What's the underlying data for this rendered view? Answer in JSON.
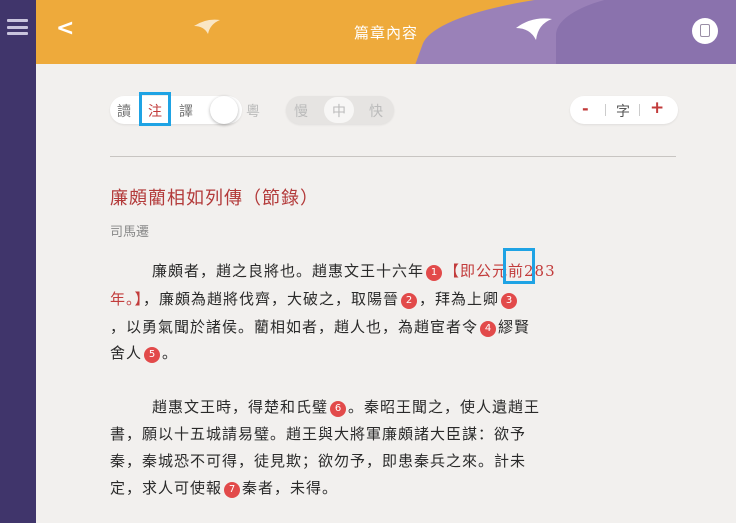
{
  "header": {
    "title": "篇章內容",
    "back_glyph": "<"
  },
  "toolbar": {
    "mode_read": "讀",
    "mode_note": "注",
    "mode_translate": "譯",
    "toggle_label": "粵",
    "speed_slow": "慢",
    "speed_mid": "中",
    "speed_fast": "快",
    "font_minus": "-",
    "font_label": "字",
    "font_plus": "+"
  },
  "article": {
    "title": "廉頗藺相如列傳（節錄）",
    "author": "司馬遷",
    "p1_l1_a": "廉頗者，趙之良將也。趙惠文王十六年",
    "note1": "1",
    "p1_l1_b": "【即公元前283",
    "p1_l2_a": "年。】",
    "p1_l2_b": "，廉頗為趙將伐齊，大破之，取陽晉",
    "note2": "2",
    "p1_l2_c": "，拜為上卿",
    "note3": "3",
    "p1_l3_a": "，以勇氣聞於諸侯。藺相如者，趙人也，為趙宦者令",
    "note4": "4",
    "p1_l3_b": "繆賢",
    "p1_l4_a": "舍人",
    "note5": "5",
    "p1_l4_b": "。",
    "p2_l1_a": "趙惠文王時，得楚和氏璧",
    "note6": "6",
    "p2_l1_b": "。秦昭王聞之，使人遺趙王",
    "p2_l2": "書，願以十五城請易璧。趙王與大將軍廉頗諸大臣謀：欲予",
    "p2_l3": "秦，秦城恐不可得，徒見欺；欲勿予，即患秦兵之來。計未",
    "p2_l4_a": "定，求人可使報",
    "note7": "7",
    "p2_l4_b": "秦者，未得。"
  }
}
